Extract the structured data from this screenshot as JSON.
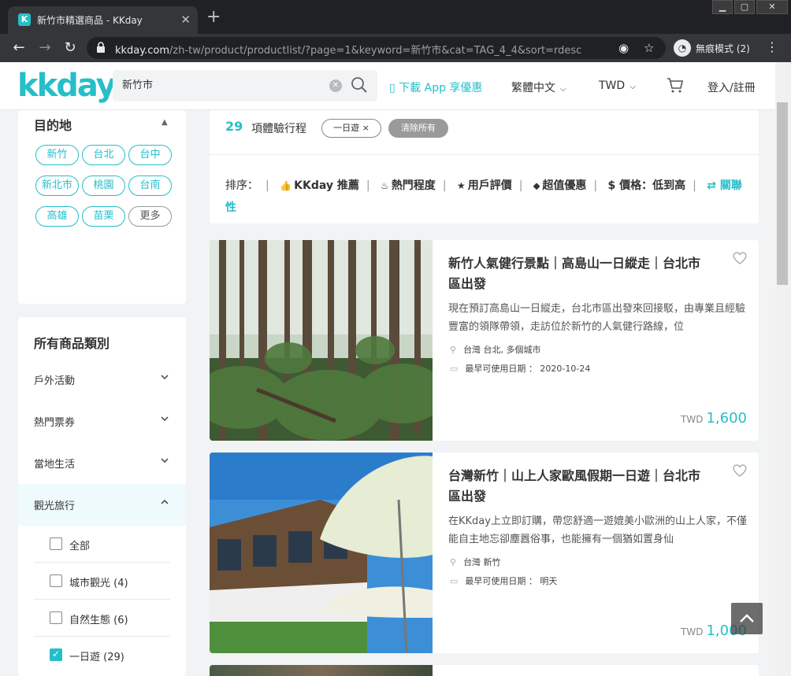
{
  "browser": {
    "tab_title": "新竹市精選商品 - KKday",
    "favicon_letter": "K",
    "url_host": "kkday.com",
    "url_path": "/zh-tw/product/productlist/?page=1&keyword=新竹市&cat=TAG_4_4&sort=rdesc",
    "incognito_label": "無痕模式 (2)"
  },
  "header": {
    "logo": "kkday",
    "search_value": "新竹市",
    "app_link": "下載 App 享優惠",
    "language": "繁體中文",
    "currency": "TWD",
    "login": "登入/註冊"
  },
  "sidebar": {
    "destination": {
      "title": "目的地",
      "chips": [
        "新竹",
        "台北",
        "台中",
        "新北市",
        "桃園",
        "台南",
        "高雄",
        "苗栗"
      ],
      "more": "更多"
    },
    "categories": {
      "title": "所有商品類別",
      "items": [
        {
          "label": "戶外活動"
        },
        {
          "label": "熱門票券"
        },
        {
          "label": "當地生活"
        },
        {
          "label": "觀光旅行"
        }
      ],
      "sub_items": [
        {
          "label": "全部",
          "checked": false
        },
        {
          "label": "城市觀光 (4)",
          "checked": false
        },
        {
          "label": "自然生態 (6)",
          "checked": false
        },
        {
          "label": "一日遊 (29)",
          "checked": true
        }
      ]
    }
  },
  "results": {
    "count": "29",
    "count_label": "項體驗行程",
    "active_filter": "一日遊 ×",
    "clear_all": "清除所有",
    "sort_label": "排序：",
    "sort_options": [
      "KKday 推薦",
      "熱門程度",
      "用戶評價",
      "超值優惠",
      "$ 價格：低到高",
      "⇄ 關聯性"
    ]
  },
  "products": [
    {
      "title": "新竹人氣健行景點｜高島山一日縱走｜台北市區出發",
      "desc": "現在預訂高島山一日縱走，台北市區出發來回接駁，由專業且經驗豐富的領隊帶領，走訪位於新竹的人氣健行路線，位",
      "location": "台灣 台北, 多個城市",
      "date_label": "最早可使用日期 ： 2020-10-24",
      "currency": "TWD",
      "price": "1,600"
    },
    {
      "title": "台灣新竹｜山上人家歐風假期一日遊｜台北市區出發",
      "desc": "在KKday上立即訂購，帶您舒適一遊媲美小歐洲的山上人家，不僅能自主地忘卻塵囂俗事，也能擁有一個猶如置身仙",
      "location": "台灣 新竹",
      "date_label": "最早可使用日期 ： 明天",
      "currency": "TWD",
      "price": "1,000"
    }
  ],
  "colors": {
    "accent": "#26bec9"
  }
}
